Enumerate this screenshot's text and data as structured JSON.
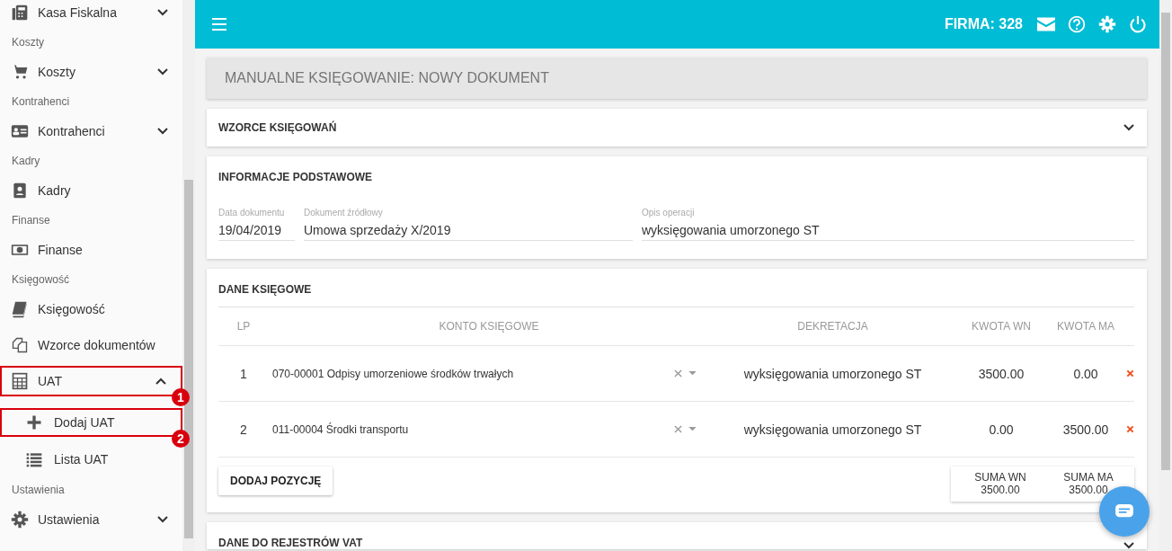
{
  "sidebar": {
    "items": [
      {
        "kind": "item",
        "label": "Kasa Fiskalna",
        "expanded": false
      },
      {
        "kind": "header",
        "label": "Koszty"
      },
      {
        "kind": "item",
        "label": "Koszty",
        "expanded": false
      },
      {
        "kind": "header",
        "label": "Kontrahenci"
      },
      {
        "kind": "item",
        "label": "Kontrahenci",
        "expanded": false
      },
      {
        "kind": "header",
        "label": "Kadry"
      },
      {
        "kind": "item",
        "label": "Kadry"
      },
      {
        "kind": "header",
        "label": "Finanse"
      },
      {
        "kind": "item",
        "label": "Finanse"
      },
      {
        "kind": "header",
        "label": "Księgowość"
      },
      {
        "kind": "item",
        "label": "Księgowość"
      },
      {
        "kind": "item",
        "label": "Wzorce dokumentów"
      },
      {
        "kind": "item",
        "label": "UAT",
        "expanded": true,
        "callout": "1"
      },
      {
        "kind": "subitem",
        "label": "Dodaj UAT",
        "callout": "2"
      },
      {
        "kind": "subitem",
        "label": "Lista UAT"
      },
      {
        "kind": "header",
        "label": "Ustawienia"
      },
      {
        "kind": "item",
        "label": "Ustawienia",
        "expanded": false
      }
    ]
  },
  "topbar": {
    "company": "FIRMA: 328"
  },
  "page_title": "MANUALNE KSIĘGOWANIE: NOWY DOKUMENT",
  "templates_panel": {
    "title": "WZORCE KSIĘGOWAŃ",
    "expanded": false
  },
  "basic_info": {
    "title": "INFORMACJE PODSTAWOWE",
    "fields": [
      {
        "label": "Data dokumentu",
        "value": "19/04/2019"
      },
      {
        "label": "Dokument źródłowy",
        "value": "Umowa sprzedaży X/2019"
      },
      {
        "label": "Opis operacji",
        "value": "wyksięgowania umorzonego ST"
      }
    ]
  },
  "entries": {
    "title": "DANE KSIĘGOWE",
    "columns": [
      "LP",
      "KONTO KSIĘGOWE",
      "DEKRETACJA",
      "KWOTA WN",
      "KWOTA MA"
    ],
    "rows": [
      {
        "lp": "1",
        "account": "070-00001 Odpisy umorzeniowe środków trwałych",
        "decree": "wyksięgowania umorzonego ST",
        "debit": "3500.00",
        "credit": "0.00"
      },
      {
        "lp": "2",
        "account": "011-00004 Środki transportu",
        "decree": "wyksięgowania umorzonego ST",
        "debit": "0.00",
        "credit": "3500.00"
      }
    ],
    "add_button": "DODAJ POZYCJĘ",
    "totals": [
      {
        "label": "SUMA WN",
        "value": "3500.00"
      },
      {
        "label": "SUMA MA",
        "value": "3500.00"
      }
    ]
  },
  "vat_panel": {
    "title": "DANE DO REJESTRÓW VAT",
    "expanded": false
  }
}
